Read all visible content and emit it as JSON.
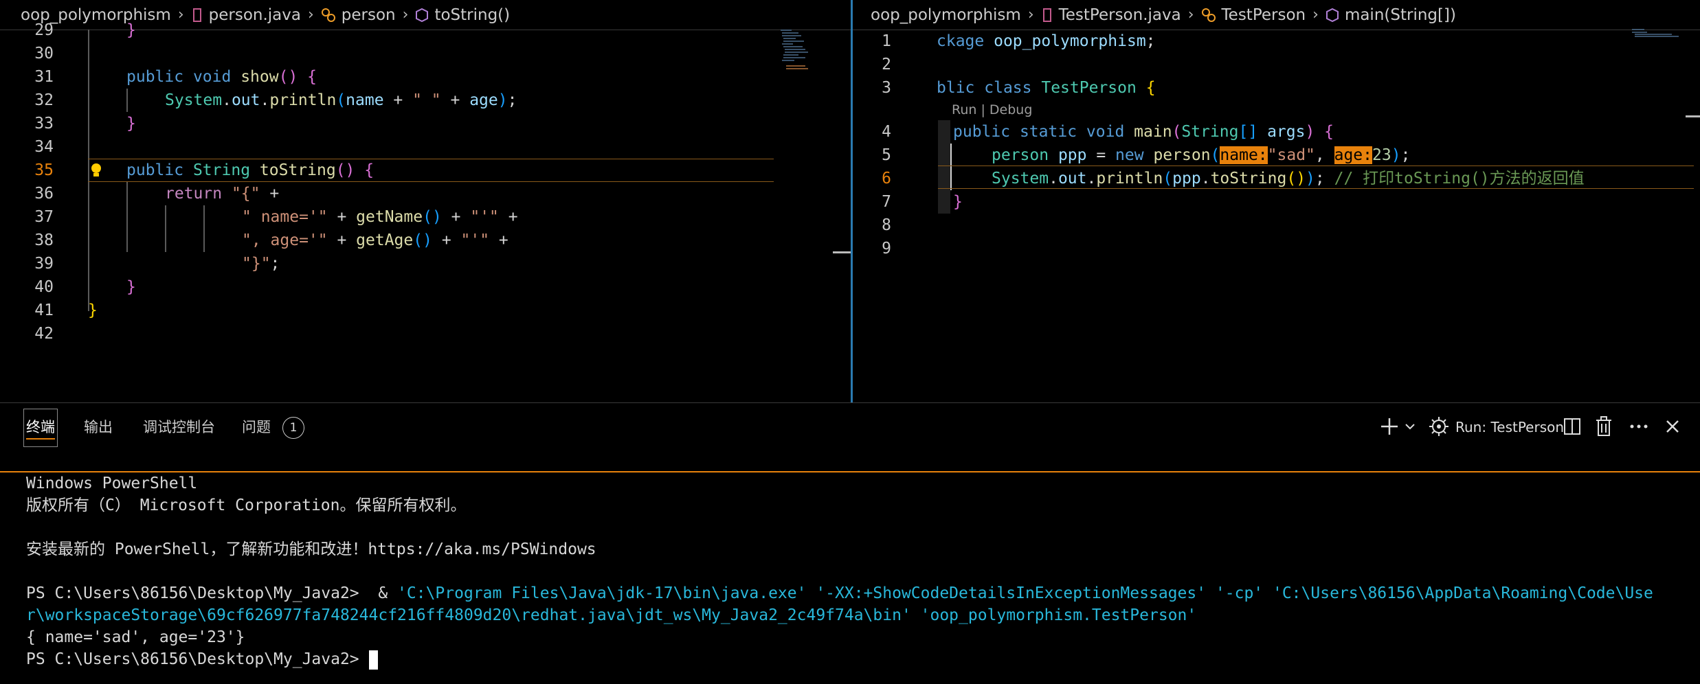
{
  "left_editor": {
    "breadcrumb": [
      "oop_polymorphism",
      "person.java",
      "person",
      "toString()"
    ],
    "line_numbers": [
      "29",
      "30",
      "31",
      "32",
      "33",
      "34",
      "35",
      "36",
      "37",
      "38",
      "39",
      "40",
      "41",
      "42"
    ],
    "code": {
      "l29_brace": "}",
      "l31": {
        "kw1": "public",
        "kw2": "void",
        "fn": "show",
        "parens": "()",
        "brace": "{"
      },
      "l32": {
        "type": "System",
        "dot1": ".",
        "field": "out",
        "dot2": ".",
        "fn": "println",
        "open": "(",
        "v1": "name",
        "plus1": " + ",
        "s1": "\" \"",
        "plus2": " + ",
        "v2": "age",
        "close": ")",
        "semi": ";"
      },
      "l33_brace": "}",
      "l35": {
        "kw1": "public",
        "type": "String",
        "fn": "toString",
        "parens": "()",
        "brace": "{"
      },
      "l36": {
        "kw": "return",
        "s": "\"{\"",
        "plus": " +"
      },
      "l37": {
        "s1": "\" name='\"",
        "plus1": " + ",
        "fn": "getName",
        "parens": "()",
        "plus2": " + ",
        "s2": "\"'\"",
        "plus3": " +"
      },
      "l38": {
        "s1": "\", age='\"",
        "plus1": " + ",
        "fn": "getAge",
        "parens": "()",
        "plus2": " + ",
        "s2": "\"'\"",
        "plus3": " +"
      },
      "l39": {
        "s": "\"}\"",
        "semi": ";"
      },
      "l40_brace": "}",
      "l41_brace": "}"
    }
  },
  "right_editor": {
    "breadcrumb": [
      "oop_polymorphism",
      "TestPerson.java",
      "TestPerson",
      "main(String[])"
    ],
    "line_numbers": [
      "1",
      "2",
      "3",
      "4",
      "5",
      "6",
      "7",
      "8",
      "9"
    ],
    "codelens": "Run | Debug",
    "code": {
      "l1": {
        "kw": "ckage",
        "id": "oop_polymorphism",
        "semi": ";"
      },
      "l3": {
        "kw": "blic",
        "kw2": "class",
        "ty": "TestPerson",
        "brace": "{"
      },
      "l4": {
        "kw1": "public",
        "kw2": "static",
        "kw3": "void",
        "fn": "main",
        "open": "(",
        "ty": "String",
        "arr": "[]",
        "id": "args",
        "close": ")",
        "brace": "{"
      },
      "l5": {
        "ty": "person",
        "id": "ppp",
        "eq": " = ",
        "kw": "new",
        "fn": "person",
        "open": "(",
        "hint1": "name:",
        "s": "\"sad\"",
        "comma": ", ",
        "hint2": "age:",
        "num": "23",
        "close": ")",
        "semi": ";"
      },
      "l6": {
        "ty": "System",
        "dot1": ".",
        "field": "out",
        "dot2": ".",
        "fn": "println",
        "open": "(",
        "id": "ppp",
        "dot3": ".",
        "fn2": "toString",
        "parens": "()",
        "close": ")",
        "semi": ";",
        "comment": "// 打印toString()方法的返回值"
      },
      "l7_brace": "}"
    }
  },
  "panel": {
    "tabs": [
      "终端",
      "输出",
      "调试控制台",
      "问题"
    ],
    "problems_count": "1",
    "run_label": "Run: TestPerson"
  },
  "terminal": {
    "line1": "Windows PowerShell",
    "line2": "版权所有（C） Microsoft Corporation。保留所有权利。",
    "line3": "安装最新的 PowerShell，了解新功能和改进！https://aka.ms/PSWindows",
    "line4_prompt": "PS C:\\Users\\86156\\Desktop\\My_Java2>  & ",
    "line4_cmd": "'C:\\Program Files\\Java\\jdk-17\\bin\\java.exe' '-XX:+ShowCodeDetailsInExceptionMessages' '-cp' 'C:\\Users\\86156\\AppData\\Roaming\\Code\\Use",
    "line5_cmd": "r\\workspaceStorage\\69cf626977fa748244cf216ff4809d20\\redhat.java\\jdt_ws\\My_Java2_2c49f74a\\bin' 'oop_polymorphism.TestPerson'",
    "line6": "{ name='sad', age='23'}",
    "line7_prompt": "PS C:\\Users\\86156\\Desktop\\My_Java2> "
  },
  "colors": {
    "accent": "#e8820c",
    "focus_border": "#2a7ab0",
    "terminal_cyan": "#29b8db"
  }
}
